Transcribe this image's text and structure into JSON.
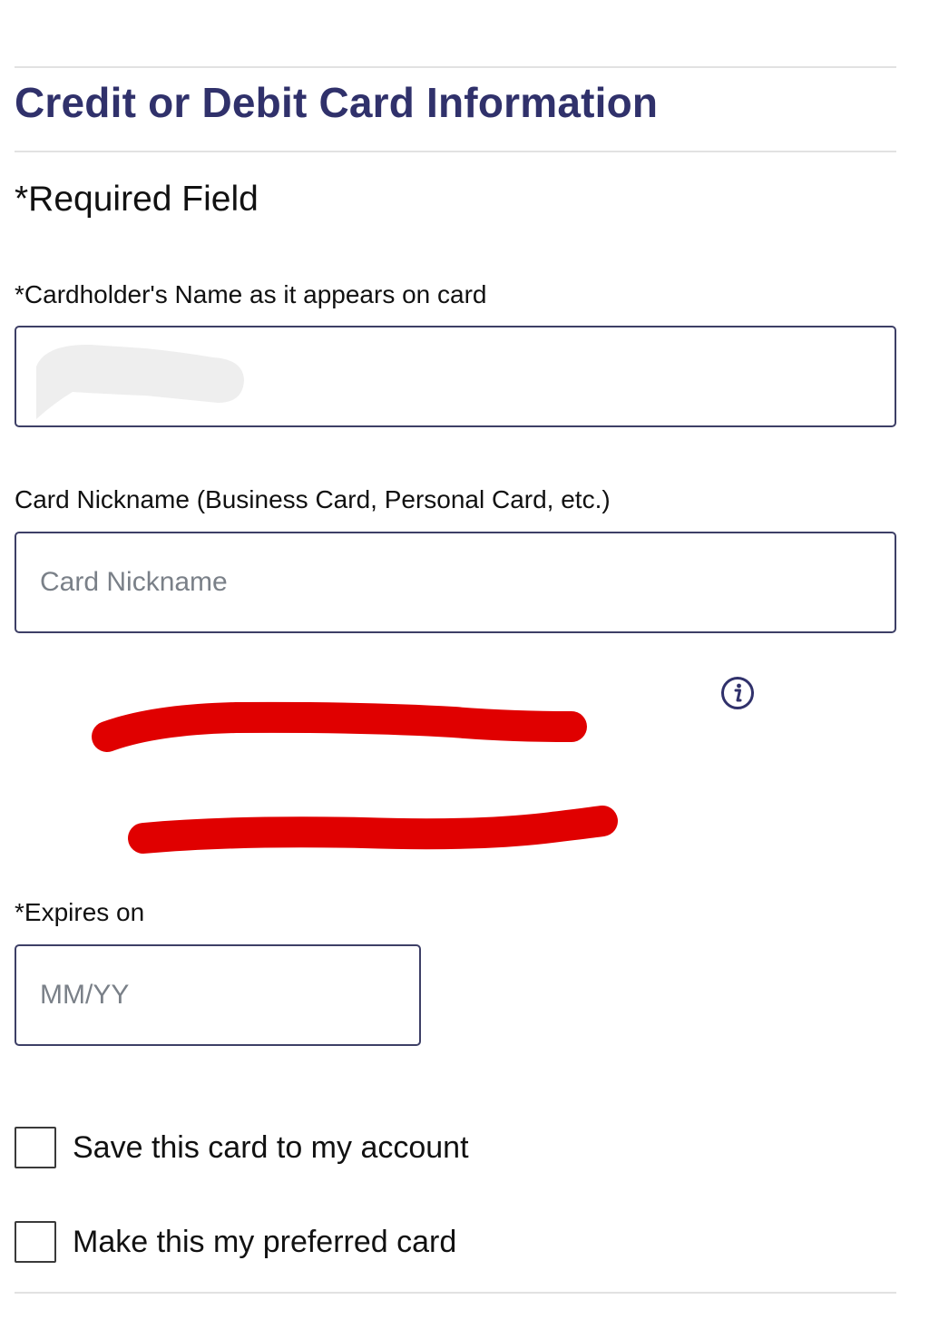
{
  "section": {
    "title": "Credit or Debit Card Information",
    "required_note": "*Required Field"
  },
  "fields": {
    "cardholder_name": {
      "label": "*Cardholder's Name as it appears on card",
      "value": ""
    },
    "nickname": {
      "label": "Card Nickname (Business Card, Personal Card, etc.)",
      "placeholder": "Card Nickname",
      "value": ""
    },
    "expires": {
      "label": "*Expires on",
      "placeholder": "MM/YY",
      "value": ""
    }
  },
  "options": {
    "save_card_label": "Save this card to my account",
    "save_card_checked": false,
    "preferred_card_label": "Make this my preferred card",
    "preferred_card_checked": false
  },
  "icons": {
    "info": "info-icon"
  },
  "colors": {
    "heading": "#30316b",
    "field_border": "#3d3f66",
    "divider": "#e2e2e2",
    "placeholder": "#7a8088",
    "redaction_marker": "#e00000"
  }
}
